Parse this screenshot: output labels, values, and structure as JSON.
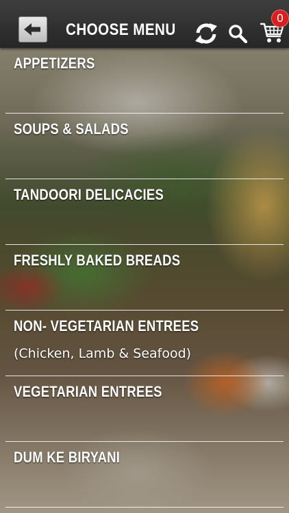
{
  "header": {
    "title": "CHOOSE MENU",
    "back_icon": "back-arrow-icon",
    "refresh_icon": "refresh-icon",
    "search_icon": "search-icon",
    "cart_icon": "cart-icon",
    "cart_count": "0",
    "badge_color": "#d42020"
  },
  "menu": {
    "items": [
      {
        "label": "APPETIZERS",
        "sublabel": ""
      },
      {
        "label": "SOUPS & SALADS",
        "sublabel": ""
      },
      {
        "label": "TANDOORI DELICACIES",
        "sublabel": ""
      },
      {
        "label": "FRESHLY BAKED BREADS",
        "sublabel": ""
      },
      {
        "label": "NON- VEGETARIAN ENTREES",
        "sublabel": "(Chicken, Lamb & Seafood)"
      },
      {
        "label": "VEGETARIAN ENTREES",
        "sublabel": ""
      },
      {
        "label": "DUM KE BIRYANI",
        "sublabel": ""
      }
    ]
  }
}
